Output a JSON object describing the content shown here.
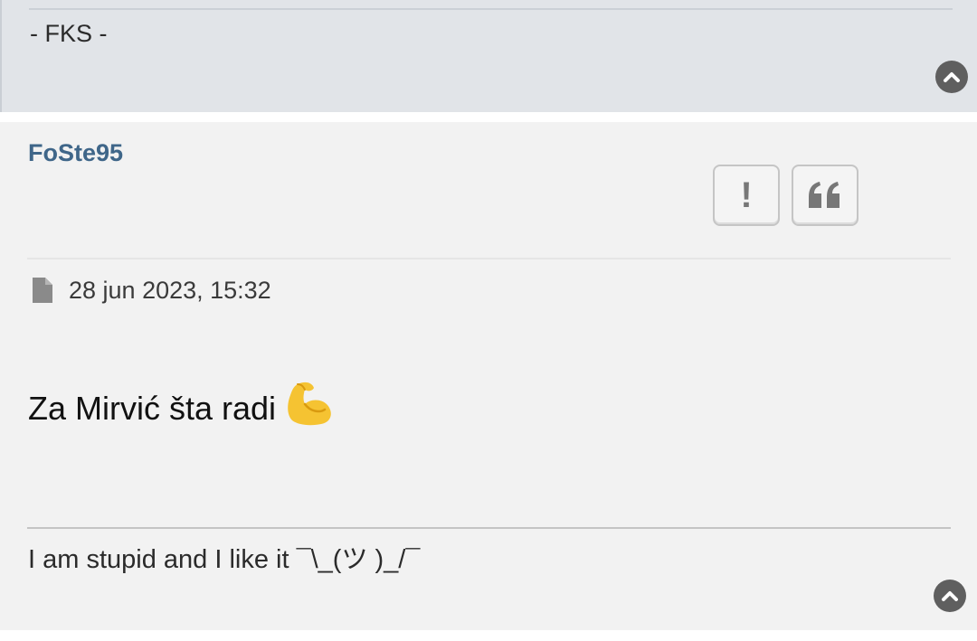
{
  "previous_post": {
    "signature": "- FKS -",
    "back_to_top_icon": "chevron-up-circle-icon"
  },
  "post": {
    "author": "FoSte95",
    "actions": {
      "report_icon": "exclamation-icon",
      "report_glyph": "!",
      "quote_icon": "quote-icon",
      "quote_glyph": "❝"
    },
    "date_icon": "file-icon",
    "date": "28 jun 2023, 15:32",
    "content_text": "Za Mirvić šta radi",
    "content_emoji": "flexed-biceps",
    "signature": "I am stupid and I like it ¯\\_(ツ )_/¯",
    "back_to_top_icon": "chevron-up-circle-icon"
  },
  "colors": {
    "author": "#3f6689",
    "previous_post_bg": "#e1e4e8",
    "post_bg": "#f2f2f2"
  }
}
